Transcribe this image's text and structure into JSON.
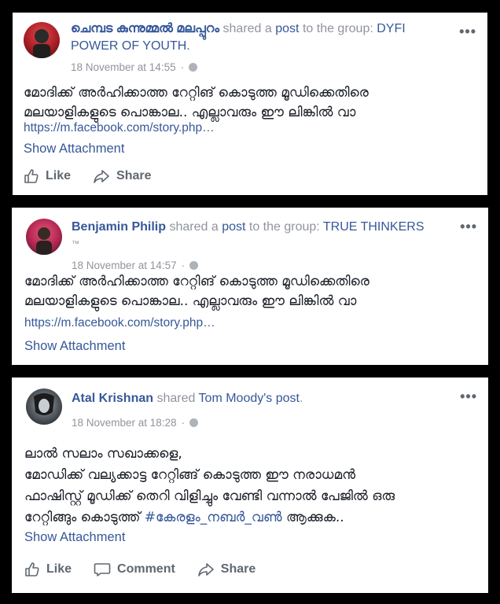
{
  "posts": [
    {
      "author": "ചെമ്പട കുന്നുമ്മൽ മലപ്പുറം",
      "shared_text": "shared a",
      "post_link": "post",
      "to_group_text": "to the group:",
      "group": "DYFI POWER OF YOUTH.",
      "time": "18 November at 14:55",
      "text_line1": "മോദിക്ക് അർഹിക്കാത്ത റേറ്റിങ് കൊടുത്ത മൂഡിക്കെതിരെ",
      "text_line2": "മലയാളികളുടെ പൊങ്കാല.. എല്ലാവരും ഈ ലിങ്കിൽ വാ",
      "url": "https://m.facebook.com/story.php…",
      "show_attachment": "Show Attachment",
      "like": "Like",
      "share": "Share",
      "avatar_colors": [
        "#c0282e",
        "#2a2a2a"
      ]
    },
    {
      "author": "Benjamin Philip",
      "shared_text": "shared a",
      "post_link": "post",
      "to_group_text": "to the group:",
      "group": "TRUE THINKERS",
      "group_tm": "™",
      "time": "18 November at 14:57",
      "text_line1": "മോദിക്ക് അർഹിക്കാത്ത റേറ്റിങ് കൊടുത്ത മൂഡിക്കെതിരെ",
      "text_line2": "മലയാളികളുടെ പൊങ്കാല.. എല്ലാവരും ഈ ലിങ്കിൽ വാ",
      "url": "https://m.facebook.com/story.php…",
      "show_attachment": "Show Attachment",
      "avatar_colors": [
        "#d63b6a",
        "#3a2a2a"
      ]
    },
    {
      "author": "Atal Krishnan",
      "shared_text": "shared",
      "shared_owner": "Tom Moody's post",
      "time": "18 November at 18:28",
      "text_line1": "ലാൽ സലാം സഖാക്കളെ,",
      "text_line2": "മോഡിക്ക് വല്യക്കാട്ട റേറ്റിങ്ങ് കൊടുത്ത ഈ നരാധമൻ",
      "text_line3": "ഫാഷിസ്റ്റ് മൂഡിക്ക് തെറി വിളിച്ചും വേണ്ടി വന്നാൽ പേജിൽ ഒരു",
      "text_line4a": "റേറ്റിങ്ങും കൊടുത്ത്",
      "hashtag": "#കേരളം_നബർ_വൺ",
      "text_line4b": "ആക്കുക..",
      "show_attachment": "Show Attachment",
      "like": "Like",
      "comment": "Comment",
      "share": "Share",
      "avatar_colors": [
        "#1a1a1a",
        "#9aa3ab"
      ]
    }
  ]
}
